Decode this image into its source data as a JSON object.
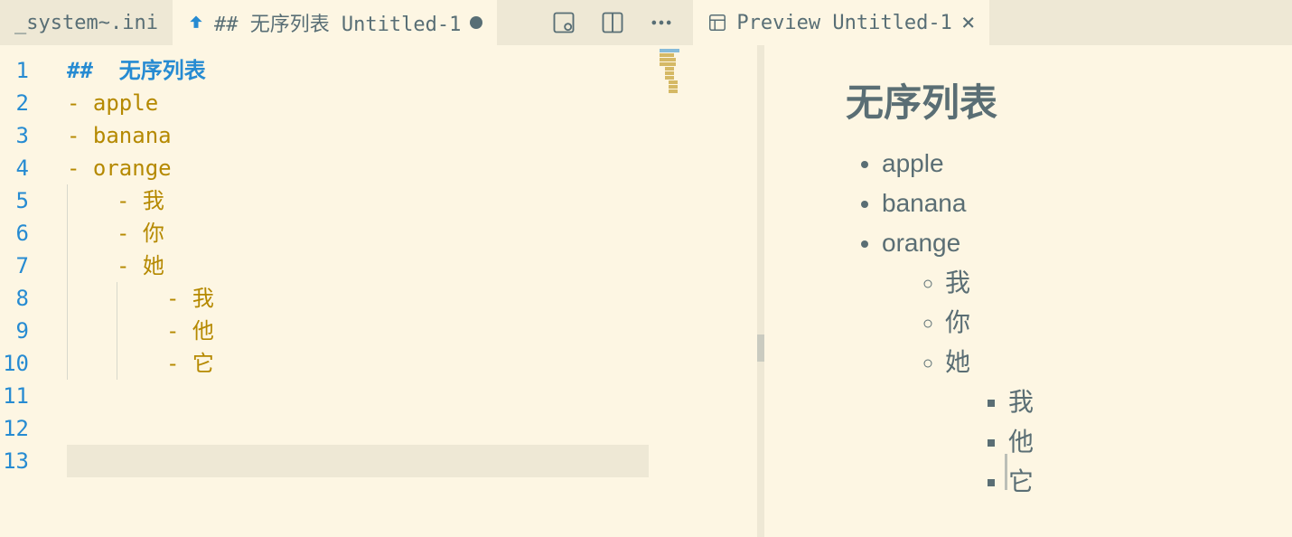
{
  "tabs": {
    "left_inactive": {
      "label": "_system~.ini"
    },
    "editor_active": {
      "label": "## 无序列表  Untitled-1"
    },
    "preview": {
      "label": "Preview Untitled-1"
    }
  },
  "editor": {
    "line_count": 13,
    "current_line": 13,
    "lines": [
      {
        "n": 1,
        "indent": 0,
        "kind": "header",
        "prefix": "##  ",
        "text": "无序列表"
      },
      {
        "n": 2,
        "indent": 0,
        "kind": "bullet",
        "prefix": "- ",
        "text": "apple"
      },
      {
        "n": 3,
        "indent": 0,
        "kind": "bullet",
        "prefix": "- ",
        "text": "banana"
      },
      {
        "n": 4,
        "indent": 0,
        "kind": "bullet",
        "prefix": "- ",
        "text": "orange"
      },
      {
        "n": 5,
        "indent": 1,
        "kind": "bullet",
        "prefix": "- ",
        "text": "我"
      },
      {
        "n": 6,
        "indent": 1,
        "kind": "bullet",
        "prefix": "- ",
        "text": "你"
      },
      {
        "n": 7,
        "indent": 1,
        "kind": "bullet",
        "prefix": "- ",
        "text": "她"
      },
      {
        "n": 8,
        "indent": 2,
        "kind": "bullet",
        "prefix": "- ",
        "text": "我"
      },
      {
        "n": 9,
        "indent": 2,
        "kind": "bullet",
        "prefix": "- ",
        "text": "他"
      },
      {
        "n": 10,
        "indent": 2,
        "kind": "bullet",
        "prefix": "- ",
        "text": "它"
      },
      {
        "n": 11,
        "indent": 0,
        "kind": "blank",
        "prefix": "",
        "text": ""
      },
      {
        "n": 12,
        "indent": 0,
        "kind": "blank",
        "prefix": "",
        "text": ""
      },
      {
        "n": 13,
        "indent": 0,
        "kind": "blank",
        "prefix": "",
        "text": ""
      }
    ]
  },
  "preview": {
    "heading": "无序列表",
    "list": [
      {
        "text": "apple"
      },
      {
        "text": "banana"
      },
      {
        "text": "orange",
        "children": [
          {
            "text": "我"
          },
          {
            "text": "你"
          },
          {
            "text": "她",
            "children": [
              {
                "text": "我"
              },
              {
                "text": "他"
              },
              {
                "text": "它"
              }
            ]
          }
        ]
      }
    ]
  }
}
